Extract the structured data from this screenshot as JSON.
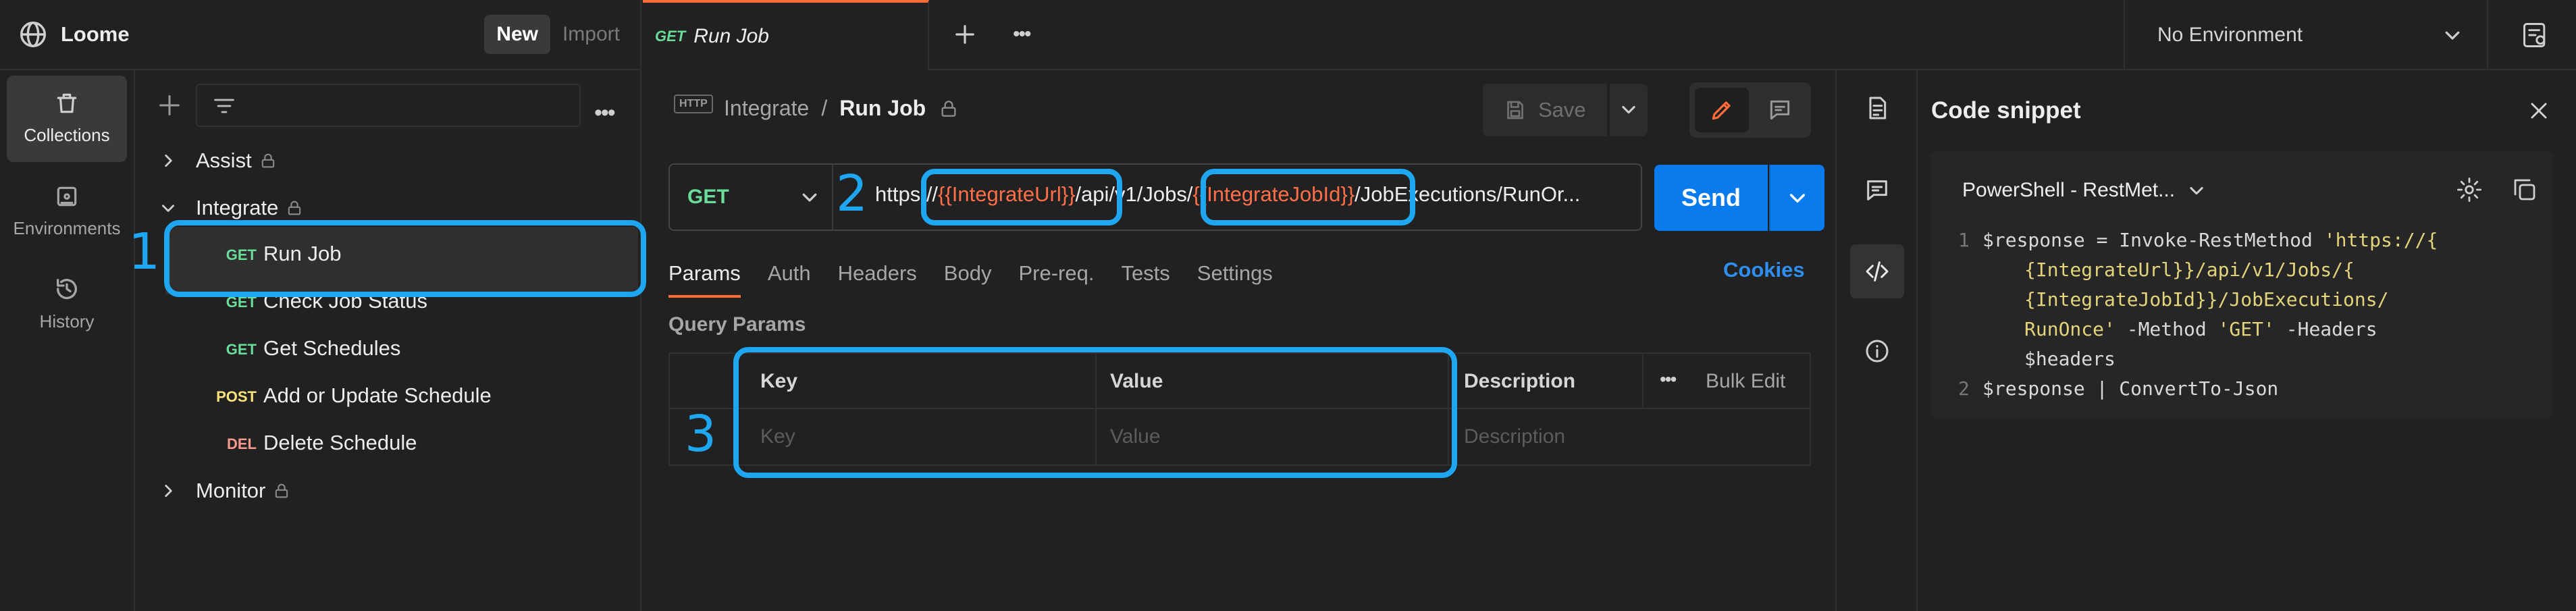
{
  "app": {
    "name": "Loome",
    "new_label": "New",
    "import_label": "Import"
  },
  "rail": {
    "collections": "Collections",
    "environments": "Environments",
    "history": "History"
  },
  "tree": {
    "assist": "Assist",
    "integrate": "Integrate",
    "monitor": "Monitor",
    "requests": [
      {
        "method": "GET",
        "name": "Run Job"
      },
      {
        "method": "GET",
        "name": "Check Job Status"
      },
      {
        "method": "GET",
        "name": "Get Schedules"
      },
      {
        "method": "POST",
        "name": "Add or Update Schedule"
      },
      {
        "method": "DEL",
        "name": "Delete Schedule"
      }
    ]
  },
  "tab": {
    "method": "GET",
    "title": "Run Job"
  },
  "environment": "No Environment",
  "breadcrumb": {
    "parent": "Integrate",
    "sep": "/",
    "current": "Run Job"
  },
  "save_label": "Save",
  "request": {
    "method": "GET",
    "url_prefix": "https://",
    "var1": "{{IntegrateUrl}}",
    "url_mid": "/api/v1/Jobs/",
    "var2": "{{IntegrateJobId}}",
    "url_suffix": "/JobExecutions/RunOr..."
  },
  "send_label": "Send",
  "subtabs": [
    "Params",
    "Auth",
    "Headers",
    "Body",
    "Pre-req.",
    "Tests",
    "Settings"
  ],
  "cookies_label": "Cookies",
  "query": {
    "title": "Query Params",
    "key": "Key",
    "value": "Value",
    "description": "Description",
    "bulk_edit": "Bulk Edit",
    "key_ph": "Key",
    "value_ph": "Value",
    "desc_ph": "Description"
  },
  "snippet": {
    "title": "Code snippet",
    "language": "PowerShell - RestMet...",
    "lines": [
      {
        "no": "1",
        "parts": [
          [
            "$response = Invoke-RestMethod ",
            "plain"
          ],
          [
            "'https://{",
            "str"
          ]
        ]
      },
      {
        "no": "",
        "parts": [
          [
            "{IntegrateUrl}}/api/v1/Jobs/{",
            "str"
          ]
        ]
      },
      {
        "no": "",
        "parts": [
          [
            "{IntegrateJobId}}/JobExecutions/",
            "str"
          ]
        ]
      },
      {
        "no": "",
        "parts": [
          [
            "RunOnce'",
            "str"
          ],
          [
            " -Method ",
            "plain"
          ],
          [
            "'GET'",
            "str"
          ],
          [
            " -Headers",
            "plain"
          ]
        ]
      },
      {
        "no": "",
        "parts": [
          [
            "$headers",
            "plain"
          ]
        ]
      },
      {
        "no": "2",
        "parts": [
          [
            "$response | ConvertTo-Json",
            "plain"
          ]
        ]
      }
    ]
  },
  "annotations": [
    "1",
    "2",
    "3"
  ],
  "colors": {
    "get": "#6bdd9a",
    "post": "#ffe47e",
    "del": "#f79a8e",
    "accent": "#097bed",
    "var": "#ff6f4a",
    "string": "#e3d47b",
    "annotation": "#1ea7f0"
  }
}
